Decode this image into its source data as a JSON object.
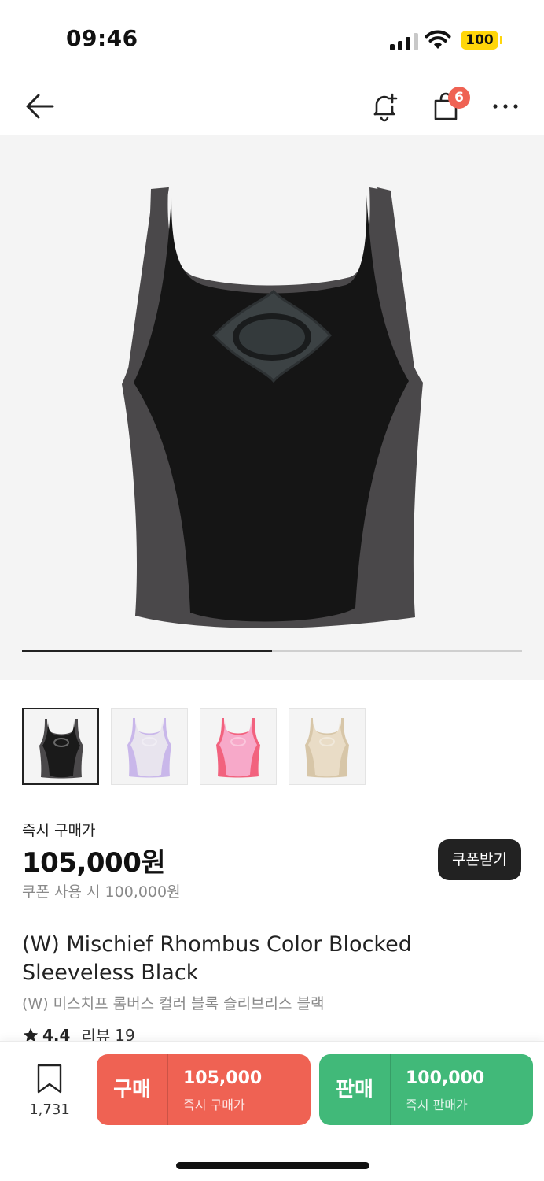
{
  "status_bar": {
    "time": "09:46",
    "battery": "100",
    "icons": [
      "signal-icon",
      "wifi-icon",
      "battery-icon"
    ]
  },
  "nav": {
    "cart_badge": "6",
    "icons": [
      "back-arrow-icon",
      "bell-plus-icon",
      "shopping-bag-icon",
      "more-icon"
    ]
  },
  "gallery": {
    "progress": 0.5,
    "thumbnails": [
      {
        "color": "#1a1a1a",
        "panel": "#4a484a",
        "trim": "#4a484a"
      },
      {
        "color": "#e8e4ee",
        "panel": "#c9b7ea",
        "trim": "#c9b7ea"
      },
      {
        "color": "#f7a9c9",
        "panel": "#f2627e",
        "trim": "#3b3b3b"
      },
      {
        "color": "#e9dcc6",
        "panel": "#d7c6a8",
        "trim": "#cdb99a"
      }
    ]
  },
  "price": {
    "label": "즉시 구매가",
    "amount": "105,000원",
    "coupon_note": "쿠폰 사용 시 100,000원",
    "coupon_button": "쿠폰받기"
  },
  "product": {
    "title_en": "(W) Mischief Rhombus Color Blocked Sleeveless Black",
    "title_ko": "(W) 미스치프 롬버스 컬러 블록 슬리브리스 블랙",
    "rating": "4.4",
    "review_label": "리뷰",
    "review_count": "19"
  },
  "bottom_bar": {
    "wish_count": "1,731",
    "buy": {
      "type": "구매",
      "price": "105,000",
      "sub": "즉시 구매가",
      "color": "#ef6253"
    },
    "sell": {
      "type": "판매",
      "price": "100,000",
      "sub": "즉시 판매가",
      "color": "#41b979"
    }
  }
}
